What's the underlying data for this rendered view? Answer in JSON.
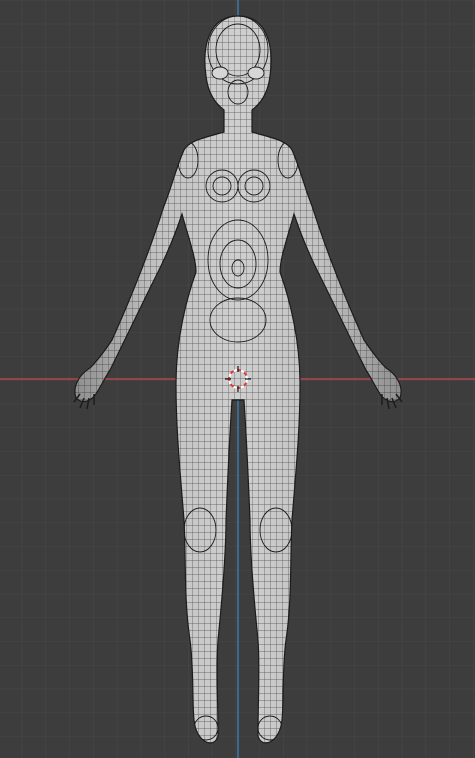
{
  "viewport": {
    "view": "front-orthographic",
    "background_color": "#3d3d3d",
    "grid_color": "#4a4a4a",
    "grid_major_color": "#545454",
    "x_axis_color": "#c84a52",
    "z_axis_color": "#3c88c6",
    "mesh_fill": "#b9b9b9",
    "mesh_shade": "#8e8e8e",
    "wire_color": "#1a1a1a",
    "cursor_color": "#d83c3c"
  },
  "object": {
    "kind": "humanoid-female-mesh",
    "display": "solid-with-wireframe",
    "pose": "A-pose"
  },
  "cursor_3d": {
    "icon": "3d-cursor-icon"
  }
}
